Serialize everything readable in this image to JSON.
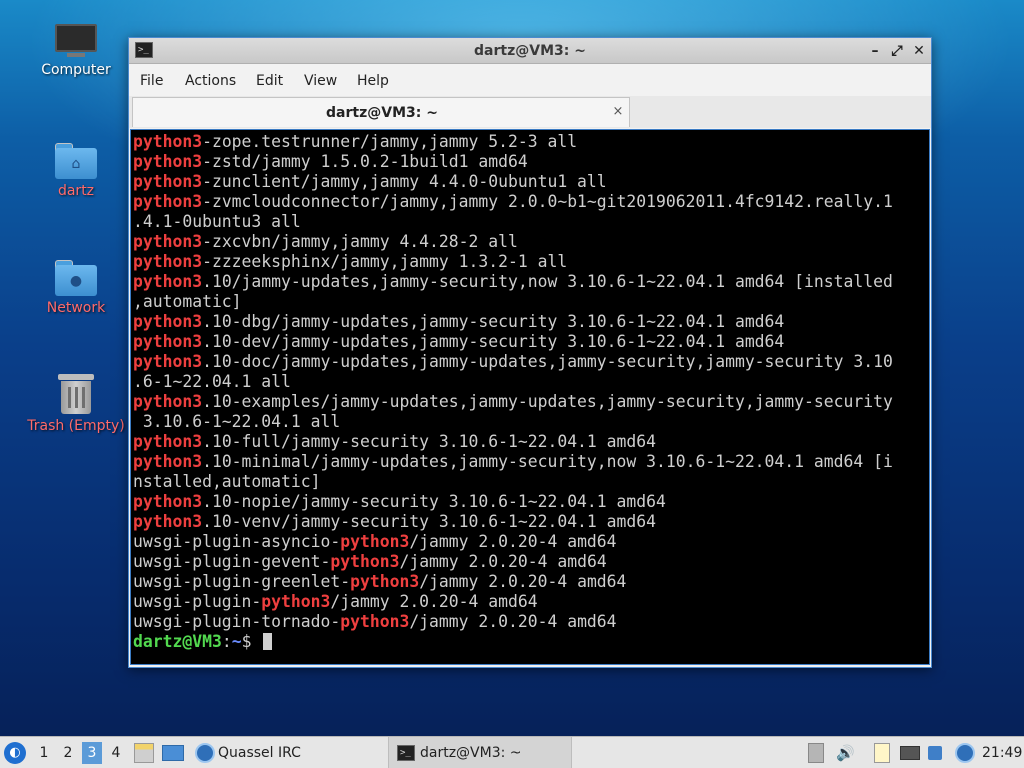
{
  "desktop": {
    "icons": [
      {
        "label": "Computer"
      },
      {
        "label": "dartz"
      },
      {
        "label": "Network"
      },
      {
        "label": "Trash (Empty)"
      }
    ]
  },
  "window": {
    "title": "dartz@VM3: ~",
    "menu": [
      "File",
      "Actions",
      "Edit",
      "View",
      "Help"
    ],
    "tab_label": "dartz@VM3: ~",
    "tab_close": "×"
  },
  "terminal": {
    "lines": [
      [
        {
          "t": "python3",
          "c": "kw"
        },
        {
          "t": "-zope.testrunner/jammy,jammy 5.2-3 all"
        }
      ],
      [
        {
          "t": "python3",
          "c": "kw"
        },
        {
          "t": "-zstd/jammy 1.5.0.2-1build1 amd64"
        }
      ],
      [
        {
          "t": "python3",
          "c": "kw"
        },
        {
          "t": "-zunclient/jammy,jammy 4.4.0-0ubuntu1 all"
        }
      ],
      [
        {
          "t": "python3",
          "c": "kw"
        },
        {
          "t": "-zvmcloudconnector/jammy,jammy 2.0.0~b1~git2019062011.4fc9142.really.1"
        }
      ],
      [
        {
          "t": ".4.1-0ubuntu3 all"
        }
      ],
      [
        {
          "t": "python3",
          "c": "kw"
        },
        {
          "t": "-zxcvbn/jammy,jammy 4.4.28-2 all"
        }
      ],
      [
        {
          "t": "python3",
          "c": "kw"
        },
        {
          "t": "-zzzeeksphinx/jammy,jammy 1.3.2-1 all"
        }
      ],
      [
        {
          "t": "python3",
          "c": "kw"
        },
        {
          "t": ".10/jammy-updates,jammy-security,now 3.10.6-1~22.04.1 amd64 [installed"
        }
      ],
      [
        {
          "t": ",automatic]"
        }
      ],
      [
        {
          "t": "python3",
          "c": "kw"
        },
        {
          "t": ".10-dbg/jammy-updates,jammy-security 3.10.6-1~22.04.1 amd64"
        }
      ],
      [
        {
          "t": "python3",
          "c": "kw"
        },
        {
          "t": ".10-dev/jammy-updates,jammy-security 3.10.6-1~22.04.1 amd64"
        }
      ],
      [
        {
          "t": "python3",
          "c": "kw"
        },
        {
          "t": ".10-doc/jammy-updates,jammy-updates,jammy-security,jammy-security 3.10"
        }
      ],
      [
        {
          "t": ".6-1~22.04.1 all"
        }
      ],
      [
        {
          "t": "python3",
          "c": "kw"
        },
        {
          "t": ".10-examples/jammy-updates,jammy-updates,jammy-security,jammy-security"
        }
      ],
      [
        {
          "t": " 3.10.6-1~22.04.1 all"
        }
      ],
      [
        {
          "t": "python3",
          "c": "kw"
        },
        {
          "t": ".10-full/jammy-security 3.10.6-1~22.04.1 amd64"
        }
      ],
      [
        {
          "t": "python3",
          "c": "kw"
        },
        {
          "t": ".10-minimal/jammy-updates,jammy-security,now 3.10.6-1~22.04.1 amd64 [i"
        }
      ],
      [
        {
          "t": "nstalled,automatic]"
        }
      ],
      [
        {
          "t": "python3",
          "c": "kw"
        },
        {
          "t": ".10-nopie/jammy-security 3.10.6-1~22.04.1 amd64"
        }
      ],
      [
        {
          "t": "python3",
          "c": "kw"
        },
        {
          "t": ".10-venv/jammy-security 3.10.6-1~22.04.1 amd64"
        }
      ],
      [
        {
          "t": "uwsgi-plugin-asyncio-"
        },
        {
          "t": "python3",
          "c": "kw"
        },
        {
          "t": "/jammy 2.0.20-4 amd64"
        }
      ],
      [
        {
          "t": "uwsgi-plugin-gevent-"
        },
        {
          "t": "python3",
          "c": "kw"
        },
        {
          "t": "/jammy 2.0.20-4 amd64"
        }
      ],
      [
        {
          "t": "uwsgi-plugin-greenlet-"
        },
        {
          "t": "python3",
          "c": "kw"
        },
        {
          "t": "/jammy 2.0.20-4 amd64"
        }
      ],
      [
        {
          "t": "uwsgi-plugin-"
        },
        {
          "t": "python3",
          "c": "kw"
        },
        {
          "t": "/jammy 2.0.20-4 amd64"
        }
      ],
      [
        {
          "t": "uwsgi-plugin-tornado-"
        },
        {
          "t": "python3",
          "c": "kw"
        },
        {
          "t": "/jammy 2.0.20-4 amd64"
        }
      ]
    ],
    "prompt_user": "dartz@VM3",
    "prompt_sep": ":",
    "prompt_path": "~",
    "prompt_symbol": "$ ",
    "colors": {
      "keyword": "#ef3f3f",
      "user": "#52d94f",
      "path": "#6b8cff"
    }
  },
  "taskbar": {
    "workspaces": [
      "1",
      "2",
      "3",
      "4"
    ],
    "active_workspace": "3",
    "apps": [
      {
        "label": "Quassel IRC",
        "icon": "quassel-icon"
      },
      {
        "label": "dartz@VM3: ~",
        "icon": "terminal-icon"
      }
    ],
    "clock": "21:49"
  }
}
